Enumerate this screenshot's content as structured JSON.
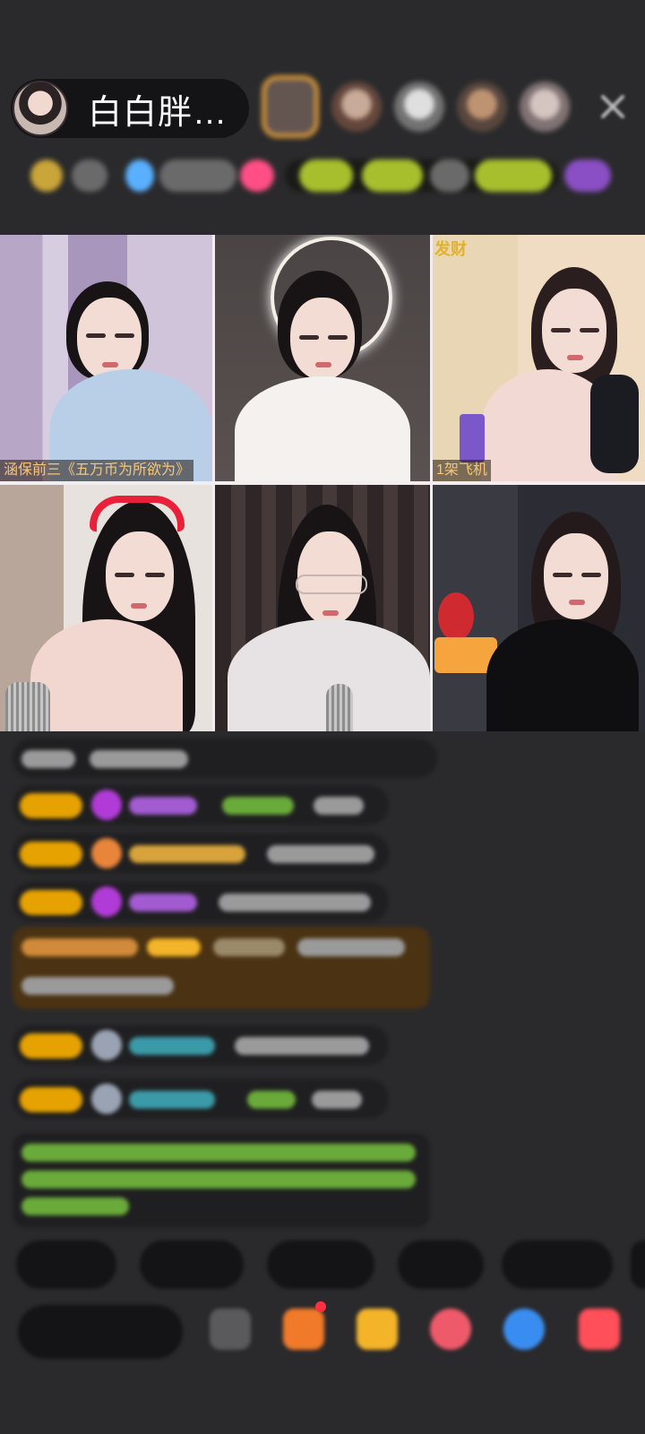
{
  "header": {
    "host_name": "白白胖…",
    "close_icon": "close-icon"
  },
  "videos": [
    {
      "id": "seat-1",
      "caption": "涵保前三《五万币为所欲为》"
    },
    {
      "id": "seat-2",
      "caption": ""
    },
    {
      "id": "seat-3",
      "caption": "1架飞机",
      "sticker": "发财"
    },
    {
      "id": "seat-4",
      "caption": ""
    },
    {
      "id": "seat-5",
      "caption": ""
    },
    {
      "id": "seat-6",
      "caption": ""
    }
  ],
  "colors": {
    "background": "#2a2a2c",
    "level_badge": "#e6a200",
    "caption_text": "#f6c67a"
  }
}
